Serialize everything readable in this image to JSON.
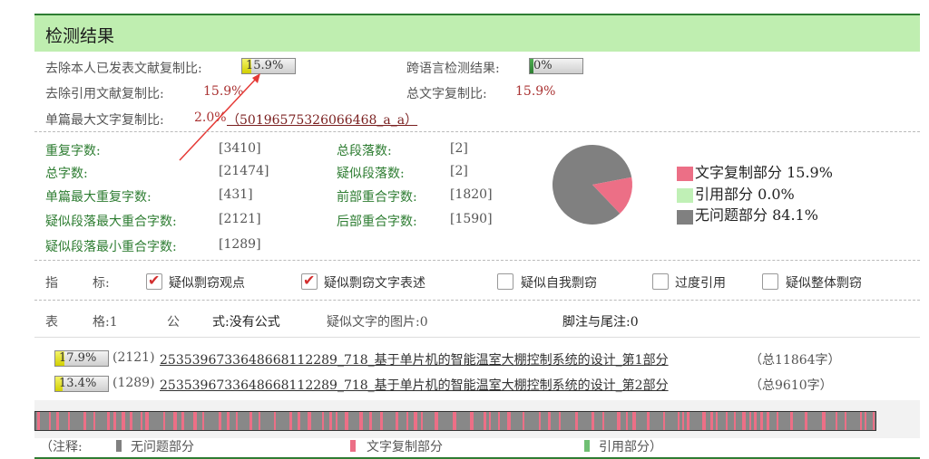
{
  "header": {
    "title": "检测结果"
  },
  "row1": {
    "exclude_self_label": "去除本人已发表文献复制比:",
    "exclude_self_value": "15.9%",
    "exclude_self_fraction": 0.159,
    "cross_lang_label": "跨语言检测结果:",
    "cross_lang_value": "0%",
    "cross_lang_fraction": 0.0
  },
  "row2": {
    "exclude_ref_label": "去除引用文献复制比:",
    "exclude_ref_value": "15.9%",
    "total_copy_label": "总文字复制比:",
    "total_copy_value": "15.9%"
  },
  "row3": {
    "single_max_label": "单篇最大文字复制比:",
    "single_max_value": "2.0%",
    "single_max_link": "（50196575326066468_a_a）"
  },
  "stats": [
    {
      "label": "重复字数:",
      "value": "[3410]"
    },
    {
      "label": "总字数:",
      "value": "[21474]"
    },
    {
      "label": "单篇最大重复字数:",
      "value": "[431]"
    },
    {
      "label": "疑似段落最大重合字数:",
      "value": "[2121]"
    },
    {
      "label": "疑似段落最小重合字数:",
      "value": "[1289]"
    }
  ],
  "stats2": [
    {
      "label": "总段落数:",
      "value": "[2]"
    },
    {
      "label": "疑似段落数:",
      "value": "[2]"
    },
    {
      "label": "前部重合字数:",
      "value": "[1820]"
    },
    {
      "label": "后部重合字数:",
      "value": "[1590]"
    }
  ],
  "pie": {
    "legend": [
      {
        "label": "文字复制部分 15.9%",
        "color": "#ec6f86",
        "value": 15.9
      },
      {
        "label": "引用部分 0.0%",
        "color": "#c0f0b6",
        "value": 0.0
      },
      {
        "label": "无问题部分 84.1%",
        "color": "#808080",
        "value": 84.1
      }
    ]
  },
  "indicators": {
    "label_a": "指",
    "label_b": "标:",
    "items": [
      {
        "label": "疑似剽窃观点",
        "checked": true
      },
      {
        "label": "疑似剽窃文字表述",
        "checked": true
      },
      {
        "label": "疑似自我剽窃",
        "checked": false
      },
      {
        "label": "过度引用",
        "checked": false
      },
      {
        "label": "疑似整体剽窃",
        "checked": false
      }
    ]
  },
  "tables": {
    "label_a": "表",
    "label_b": "格:1",
    "formula_a": "公",
    "formula_b": "式:没有公式",
    "images": "疑似文字的图片:0",
    "footnotes": "脚注与尾注:0"
  },
  "sources": [
    {
      "pct": "17.9%",
      "fraction": 0.179,
      "count": "(2121)",
      "title": "2535396733648668112289_718_基于单片机的智能温室大棚控制系统的设计_第1部分",
      "total": "（总11864字）"
    },
    {
      "pct": "13.4%",
      "fraction": 0.134,
      "count": "(1289)",
      "title": "2535396733648668112289_718_基于单片机的智能温室大棚控制系统的设计_第2部分",
      "total": "（总9610字）"
    }
  ],
  "notes": {
    "prefix": "（注释:",
    "ok": "无问题部分",
    "copy": "文字复制部分",
    "ref": "引用部分）"
  },
  "colors": {
    "copy": "#ec6f86",
    "ok": "#808080",
    "ref": "#6fbf73",
    "header": "#bfeeb0",
    "accent": "#2e7d32"
  }
}
